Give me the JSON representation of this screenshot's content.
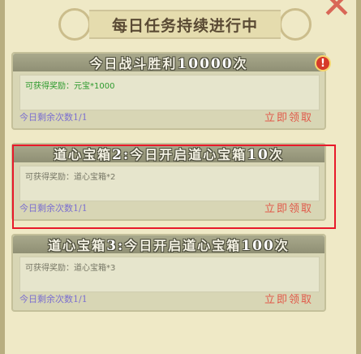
{
  "title": "每日任务持续进行中",
  "close_symbol": "✕",
  "tasks": [
    {
      "header_prefix": "今日战斗胜利",
      "header_number": "10000",
      "header_suffix": "次",
      "reward": "可获得奖励：元宝*1000",
      "remaining": "今日剩余次数1/1",
      "claim": "立即领取",
      "alert": "!"
    },
    {
      "header_prefix": "道心宝箱",
      "header_index": "2:",
      "header_mid": "今日开启道心宝箱",
      "header_number": "10",
      "header_suffix": "次",
      "reward": "可获得奖励：道心宝箱*2",
      "remaining": "今日剩余次数1/1",
      "claim": "立即领取"
    },
    {
      "header_prefix": "道心宝箱",
      "header_index": "3:",
      "header_mid": "今日开启道心宝箱",
      "header_number": "100",
      "header_suffix": "次",
      "reward": "可获得奖励：道心宝箱*3",
      "remaining": "今日剩余次数1/1",
      "claim": "立即领取"
    }
  ],
  "colors": {
    "claim": "#e15a4a",
    "remaining": "#7b6fd0",
    "reward_highlight": "#2e9a2e",
    "highlight_border": "#e8192a"
  }
}
